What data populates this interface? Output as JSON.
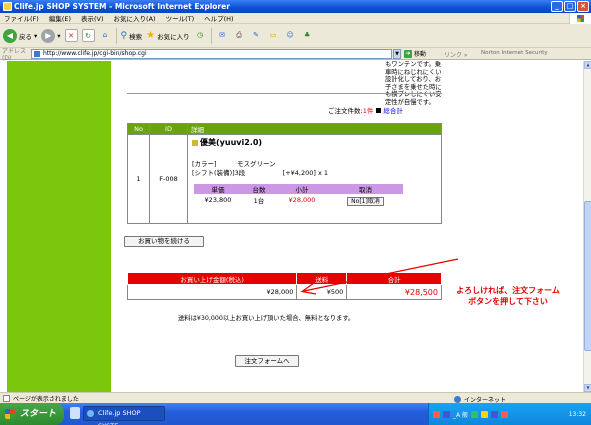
{
  "window": {
    "title": "Clife.jp SHOP SYSTEM - Microsoft Internet Explorer",
    "controls": [
      "_",
      "□",
      "×"
    ]
  },
  "menu": [
    "ファイル(F)",
    "編集(E)",
    "表示(V)",
    "お気に入り(A)",
    "ツール(T)",
    "ヘルプ(H)"
  ],
  "toolbar": {
    "back_label": "戻る",
    "search_label": "検索",
    "favorites_label": "お気に入り"
  },
  "address": {
    "label": "アドレス(D)",
    "url": "http://www.clife.jp/cgi-bin/shop.cgi",
    "go_label": "移動",
    "links_label": "リンク",
    "norton_label": "Norton Internet Security"
  },
  "page": {
    "description_text": "もワンテンです。乗車時にねじれにくい設計化しており、お子さまを乗せた時にも横ブレしにくい安定性が自慢です。",
    "cart_summary": {
      "prefix": "ご注文件数:",
      "count": "1件",
      "total_link": "総合計"
    },
    "cart_table": {
      "headers": [
        "No",
        "ID",
        "詳細"
      ],
      "row": {
        "no": "1",
        "id": "F-008",
        "product_name": "優美(yuuvi2.0)",
        "color_label": "[カラー]",
        "color_value": "モスグリーン",
        "shift_label": "[シフト(装備)]",
        "shift_value": "3段",
        "price_note": "[+¥4,200] x 1",
        "sub_headers": [
          "単価",
          "台数",
          "小計",
          "取消"
        ],
        "unit_price": "¥23,800",
        "quantity": "1台",
        "subtotal": "¥28,000",
        "cancel_label": "No[1]取消"
      }
    },
    "continue_button": "お買い物を続ける",
    "totals": {
      "headers": [
        "お買い上げ金額(税込)",
        "送料",
        "合計"
      ],
      "amount": "¥28,000",
      "shipping": "¥500",
      "total": "¥28,500"
    },
    "shipping_note": "送料は¥30,000以上お買い上げ頂いた場合、無料となります。",
    "order_button": "注文フォームへ",
    "annotation": [
      "よろしければ、注文フォーム",
      "ボタンを押して下さい"
    ]
  },
  "statusbar": {
    "text": "ページが表示されました",
    "zone": "インターネット"
  },
  "taskbar": {
    "start_label": "スタート",
    "task_label": "Clife.jp SHOP SYSTE...",
    "tray_text": "_A 般",
    "clock": "13:32"
  },
  "colors": {
    "sidebar_green": "#7ac70d",
    "cart_header_green": "#6aa40c",
    "subheader_purple": "#cc98e6",
    "totals_red": "#e60000"
  }
}
